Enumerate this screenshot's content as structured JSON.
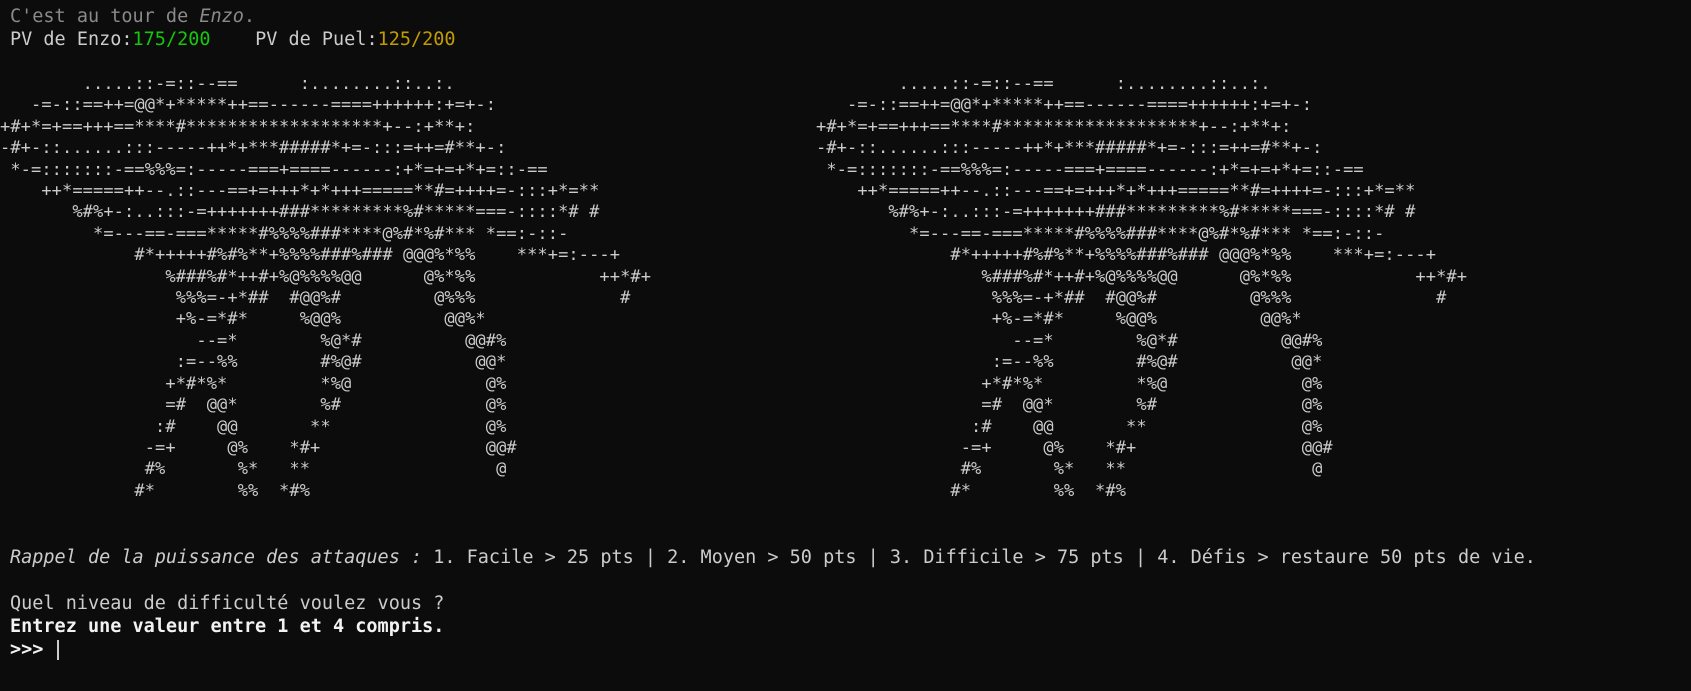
{
  "turn": {
    "prefix": "C'est au tour de ",
    "player": "Enzo",
    "suffix": "."
  },
  "hp": {
    "p1_label": "PV de Enzo:",
    "p1_value": "175/200",
    "gap": "    ",
    "p2_label": "PV de Puel:",
    "p2_value": "125/200"
  },
  "ascii_art": "        .....::-=::--==      :........::..:.\n   -=-::==++=@@*+*****++==------====++++++:+=+-:\n+#+*=+==+++==****#*******************+--:+**+:\n-#+-::......:::-----++*+***#####*+=-:::=++=#**+-:\n *-=:::::::-==%%%=:-----===+====------:+*=+=+*+=::-==\n    ++*=====++--.::---==+=+++*+*+++=====**#=++++=-:::+*=**\n       %#%+-:..:::-=+++++++###*********%#*****===-::::*# #\n         *=---==-===*****#%%%%###****@%#*%#*** *==:-::-\n             #*+++++#%#%**+%%%%###%### @@@%*%%    ***+=:---+\n                %###%#*++#+%@%%%%@@      @%*%%            ++*#+\n                 %%%=-+*##  #@@%#         @%%%              #\n                 +%-=*#*     %@@%          @@%*\n                   --=*        %@*#          @@#%\n                 :=--%%        #%@#           @@*\n                +*#*%*         *%@             @%\n                =#  @@*        %#              @%\n               :#    @@       **               @%\n              -=+     @%    *#+                @@#\n              #%       %*   **                  @\n             #*        %%  *#%",
  "hint": {
    "italic": "Rappel de la puissance des attaques :",
    "rest": " 1. Facile > 25 pts | 2. Moyen > 50 pts | 3. Difficile > 75 pts | 4. Défis > restaure 50 pts de vie."
  },
  "question": "Quel niveau de difficulté voulez vous ?",
  "instruction": "Entrez une valeur entre 1 et 4 compris.",
  "prompt": ">>> ",
  "colors": {
    "background": "#0c0c0c",
    "text": "#cccccc",
    "hp_player1": "#16c60c",
    "hp_player2": "#c19c00"
  }
}
